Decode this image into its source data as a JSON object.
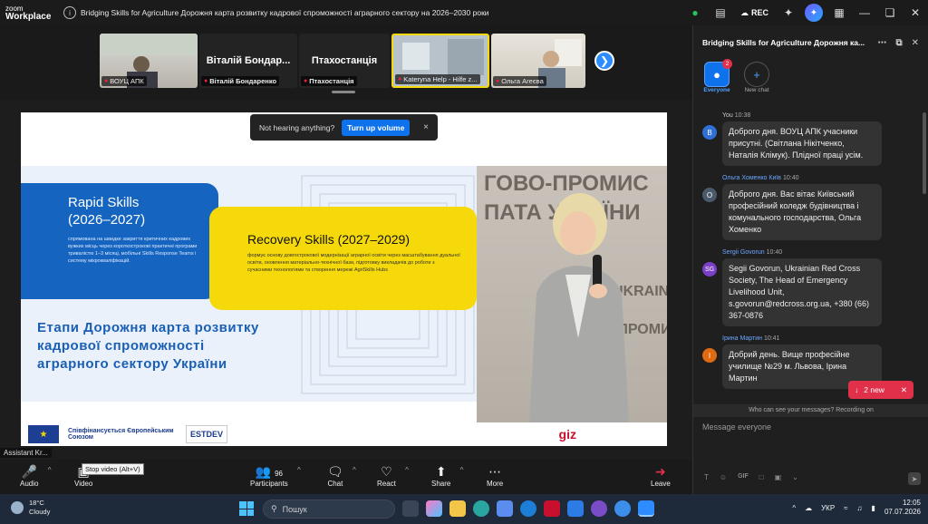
{
  "titlebar": {
    "logo_line1": "zoom",
    "logo_line2": "Workplace",
    "meeting_title": "Bridging Skills for Agriculture  Дорожня карта розвитку кадрової спроможності аграрного сектору на 2026–2030 роки",
    "rec_label": "REC"
  },
  "thumbnails": [
    {
      "name": "ВОУЦ АПК"
    },
    {
      "name": "Віталій Бондаренко",
      "big_label": "Віталій Бондар..."
    },
    {
      "name": "Птахостанція",
      "big_label": "Птахостанція"
    },
    {
      "name": "Kateryna Help - Hilfe z..."
    },
    {
      "name": "Ольга Агеєва"
    }
  ],
  "toast": {
    "text": "Not hearing anything?",
    "button": "Turn up volume",
    "close": "×"
  },
  "slide": {
    "rapid_title": "Rapid Skills\n(2026–2027)",
    "rapid_desc": "спрямована на швидке закриття критичних кадрових вужких місць через короткострокові практичні програми тривалістю 1–3 місяці, мобільні Skills Response Teams і систему мікрокваліфікацій.",
    "recovery_title": "Recovery Skills (2027–2029)",
    "recovery_desc": "формує основу довгострокової модернізації аграрної освіти через масштабування дуальної освіти, оновлення матеріально-технічної бази, підготовку викладачів до роботи з сучасними технологіями та створення мережі AgriSkills Hubs",
    "etapy": "Етапи Дорожня карта розвитку\nкадрової спроможності\nаграрного сектору України",
    "bg_text_1": "ГОВО-ПРОМИС",
    "bg_text_2": "ПАТА УКРАЇНИ",
    "bg_text_3": "UKRAINIAN",
    "bg_text_4": "-ПРОМИС",
    "logo_eu": "Співфінансується Європейським Союзом",
    "logo_estdev": "ESTDEV",
    "logo_giz": "giz"
  },
  "assistant_label": "Assistant Kr...",
  "tooltip": "Stop video (Alt+V)",
  "toolbar": {
    "audio": "Audio",
    "video": "Video",
    "participants": "Participants",
    "participants_count": "96",
    "chat": "Chat",
    "react": "React",
    "share": "Share",
    "more": "More",
    "leave": "Leave"
  },
  "chat": {
    "title": "Bridging Skills for Agriculture  Дорожня ка...",
    "channels": [
      {
        "label": "Everyone",
        "badge": "2"
      },
      {
        "label": "New chat"
      }
    ],
    "messages": [
      {
        "avatar": "B",
        "color": "#2f6fd6",
        "name": "You",
        "time": "10:38",
        "text": "Доброго дня. ВОУЦ АПК учасники присутні. (Світлана Нікітченко, Наталія Клімук). Плідної праці усім."
      },
      {
        "avatar": "O",
        "color": "#4a5a6a",
        "name": "Ольга Хоменко Київ",
        "time": "10:40",
        "text": "Доброго дня. Вас вітає Київський професійний коледж будівництва і комунального господарства, Ольга Хоменко"
      },
      {
        "avatar": "SG",
        "color": "#7b3fc8",
        "name": "Sergii Govorun",
        "time": "10:40",
        "text": "Segii Govorun, Ukrainian Red Cross Society, The Head of Emergency Livelihood Unit, s.govorun@redcross.org.ua, +380 (66) 367-0876"
      },
      {
        "avatar": "I",
        "color": "#e06a10",
        "name": "Ірина Мартин",
        "time": "10:41",
        "text": "Добрий день. Вище професійне училище №29 м. Львова, Ірина Мартин"
      }
    ],
    "new_badge": "2 new",
    "who_can_see": "Who can see your messages? Recording on",
    "compose_placeholder": "Message everyone"
  },
  "taskbar": {
    "temp": "18°C",
    "weather": "Cloudy",
    "search_placeholder": "Пошук",
    "lang": "УКР",
    "time": "12:05",
    "date": "07.07.2026"
  },
  "colors": {
    "accent": "#0e72ed",
    "danger": "#e0304a",
    "slide_blue": "#1565c0",
    "slide_yellow": "#f5d90a"
  }
}
